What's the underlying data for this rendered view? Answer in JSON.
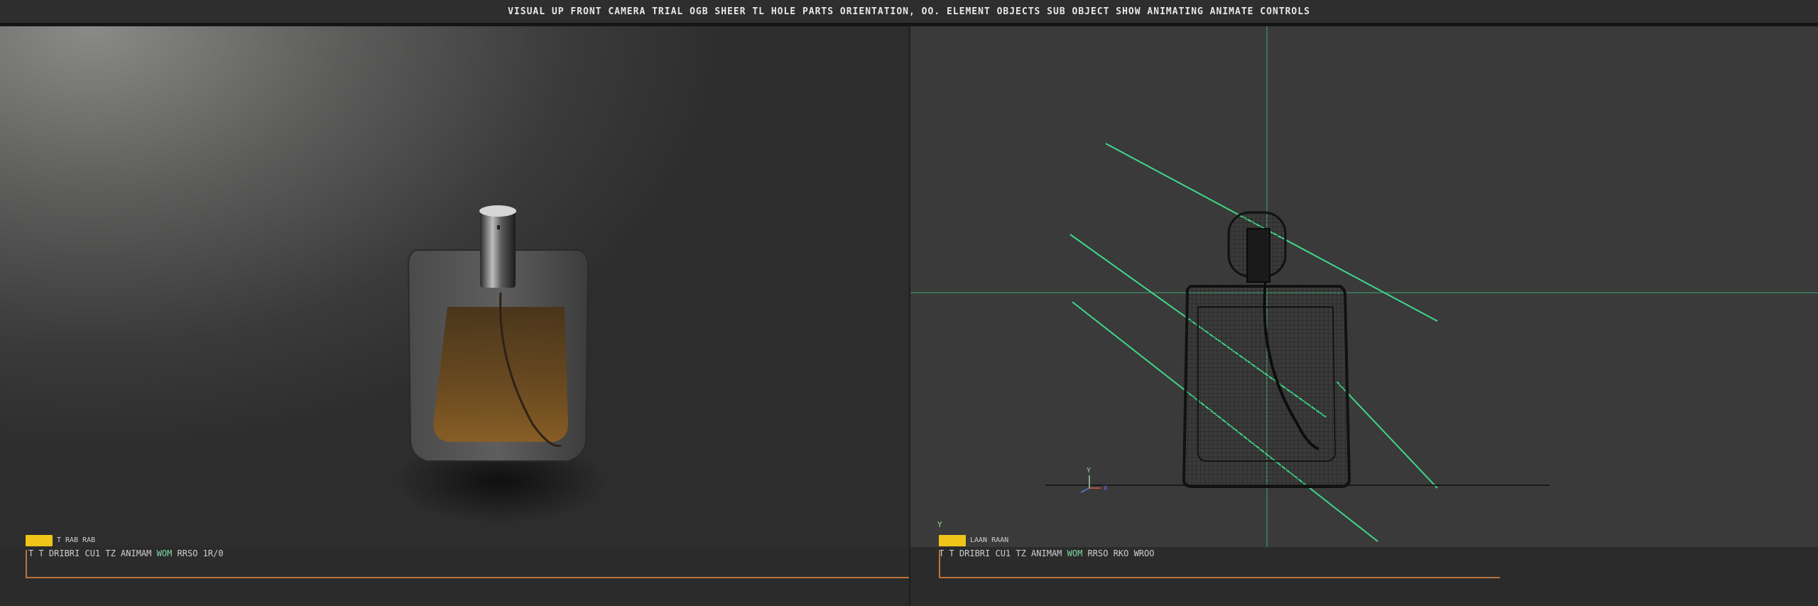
{
  "window": {
    "title": "VISUAL UP FRONT CAMERA TRIAL OGB SHEER TL HOLE PARTS ORIENTATION, OO. ELEMENT OBJECTS SUB OBJECT SHOW ANIMATING ANIMATE CONTROLS"
  },
  "viewport_left": {
    "key_label": "T RAB RAB",
    "readout": {
      "part1": "T T DRIBRI CU1 TZ ANIMAM",
      "highlight": "WOM",
      "part2": "RRSO 1R/0"
    }
  },
  "viewport_right": {
    "axis_label_y": "Y",
    "gizmo": {
      "y": "Y",
      "x": "X"
    },
    "key_label": "LAAN RAAN",
    "readout": {
      "part1": "T T DRIBRI CU1 TZ ANIMAM",
      "highlight": "WOM",
      "part2": "RRSO RKO WROO"
    }
  },
  "colors": {
    "accent_key": "#f0c419",
    "timeline_line": "#b8743e",
    "guide_lines": "#3fd88a",
    "liquid": "#6b4a1e"
  },
  "icons": [
    "perfume-bottle-render",
    "perfume-bottle-wireframe",
    "axis-gizmo-icon"
  ]
}
